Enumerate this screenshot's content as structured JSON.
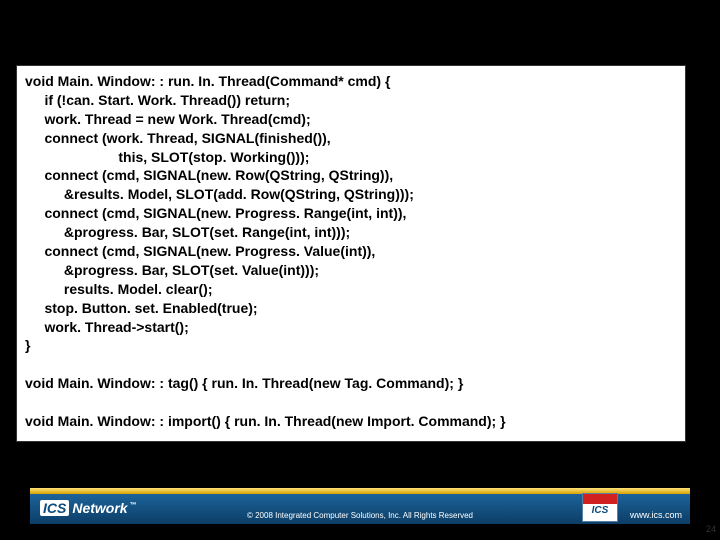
{
  "code_block": "void Main. Window: : run. In. Thread(Command* cmd) {\n     if (!can. Start. Work. Thread()) return;\n     work. Thread = new Work. Thread(cmd);\n     connect (work. Thread, SIGNAL(finished()),\n                        this, SLOT(stop. Working()));\n     connect (cmd, SIGNAL(new. Row(QString, QString)),\n          &results. Model, SLOT(add. Row(QString, QString)));\n     connect (cmd, SIGNAL(new. Progress. Range(int, int)),\n          &progress. Bar, SLOT(set. Range(int, int)));\n     connect (cmd, SIGNAL(new. Progress. Value(int)),\n          &progress. Bar, SLOT(set. Value(int)));\n          results. Model. clear();\n     stop. Button. set. Enabled(true);\n     work. Thread->start();\n}\n\nvoid Main. Window: : tag() { run. In. Thread(new Tag. Command); }\n\nvoid Main. Window: : import() { run. In. Thread(new Import. Command); }",
  "footer": {
    "brand_ics": "ICS",
    "brand_net": "Network",
    "tm": "™",
    "copyright": "© 2008 Integrated Computer Solutions, Inc. All Rights Reserved",
    "logo_text": "ICS",
    "url": "www.ics.com"
  },
  "page_number": "24"
}
